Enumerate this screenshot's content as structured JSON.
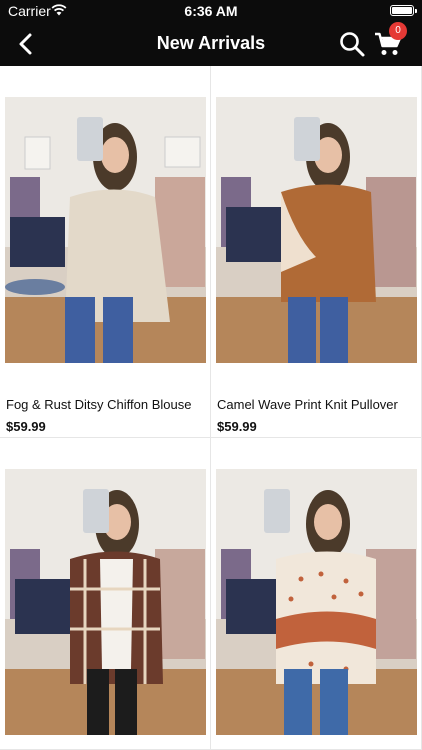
{
  "status_bar": {
    "carrier": "Carrier",
    "time": "6:36 AM"
  },
  "nav": {
    "title": "New Arrivals",
    "cart_count": "0"
  },
  "icons": {
    "back": "chevron-left-icon",
    "search": "search-icon",
    "cart": "cart-icon",
    "wifi": "wifi-icon",
    "battery": "battery-icon"
  },
  "colors": {
    "nav_bg": "#0c0c0c",
    "badge": "#e53935"
  },
  "products": [
    {
      "name": "Fog & Rust Ditsy Chiffon Blouse",
      "price": "$59.99"
    },
    {
      "name": "Camel Wave Print Knit Pullover",
      "price": "$59.99"
    },
    {
      "name": "",
      "price": ""
    },
    {
      "name": "",
      "price": ""
    }
  ]
}
